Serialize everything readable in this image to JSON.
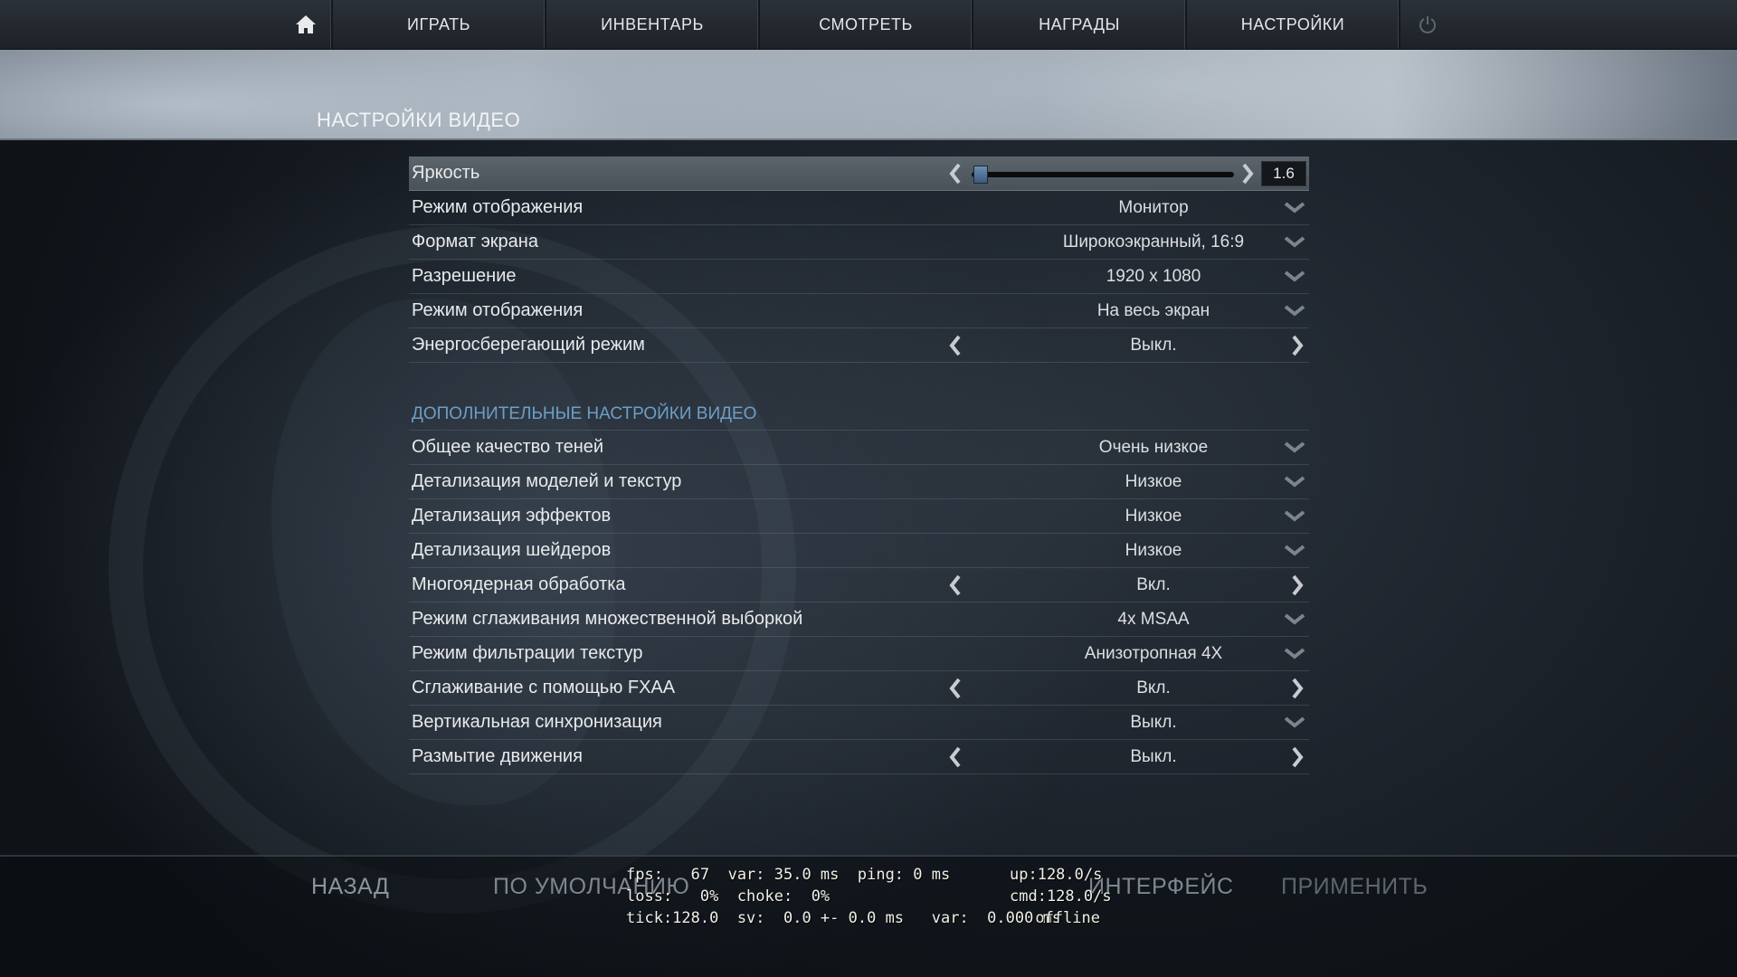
{
  "nav": {
    "items": [
      "ИГРАТЬ",
      "ИНВЕНТАРЬ",
      "СМОТРЕТЬ",
      "НАГРАДЫ",
      "НАСТРОЙКИ"
    ]
  },
  "page_title": "НАСТРОЙКИ ВИДЕО",
  "brightness": {
    "label": "Яркость",
    "value": "1.6",
    "level": 0.0
  },
  "basic_settings": [
    {
      "label": "Режим отображения",
      "value": "Монитор",
      "control": "dropdown"
    },
    {
      "label": "Формат экрана",
      "value": "Широкоэкранный, 16:9",
      "control": "dropdown"
    },
    {
      "label": "Разрешение",
      "value": "1920 x 1080",
      "control": "dropdown"
    },
    {
      "label": "Режим отображения",
      "value": "На весь экран",
      "control": "dropdown"
    },
    {
      "label": "Энергосберегающий режим",
      "value": "Выкл.",
      "control": "toggle"
    }
  ],
  "advanced_title": "ДОПОЛНИТЕЛЬНЫЕ НАСТРОЙКИ ВИДЕО",
  "advanced_settings": [
    {
      "label": "Общее качество теней",
      "value": "Очень низкое",
      "control": "dropdown"
    },
    {
      "label": "Детализация моделей и текстур",
      "value": "Низкое",
      "control": "dropdown"
    },
    {
      "label": "Детализация эффектов",
      "value": "Низкое",
      "control": "dropdown"
    },
    {
      "label": "Детализация шейдеров",
      "value": "Низкое",
      "control": "dropdown"
    },
    {
      "label": "Многоядерная обработка",
      "value": "Вкл.",
      "control": "toggle"
    },
    {
      "label": "Режим сглаживания множественной выборкой",
      "value": "4x MSAA",
      "control": "dropdown"
    },
    {
      "label": "Режим фильтрации текстур",
      "value": "Анизотропная 4X",
      "control": "dropdown"
    },
    {
      "label": "Сглаживание с помощью FXAA",
      "value": "Вкл.",
      "control": "toggle"
    },
    {
      "label": "Вертикальная синхронизация",
      "value": "Выкл.",
      "control": "dropdown"
    },
    {
      "label": "Размытие движения",
      "value": "Выкл.",
      "control": "toggle"
    }
  ],
  "bottom": {
    "back": "НАЗАД",
    "defaults": "ПО УМОЛЧАНИЮ",
    "interface": "ИНТЕРФЕЙС",
    "apply": "ПРИМЕНИТЬ"
  },
  "netgraph": {
    "line1": "fps:   67  var: 35.0 ms  ping: 0 ms",
    "line2": "loss:   0%  choke:  0%",
    "line3": "tick:128.0  sv:  0.0 +- 0.0 ms   var:  0.000 ms",
    "up": "up:128.0/s",
    "cmd": "cmd:128.0/s",
    "status": "offline"
  },
  "colors": {
    "accent_section": "#6c9fc6",
    "slider_thumb": "#5a7ea6"
  }
}
